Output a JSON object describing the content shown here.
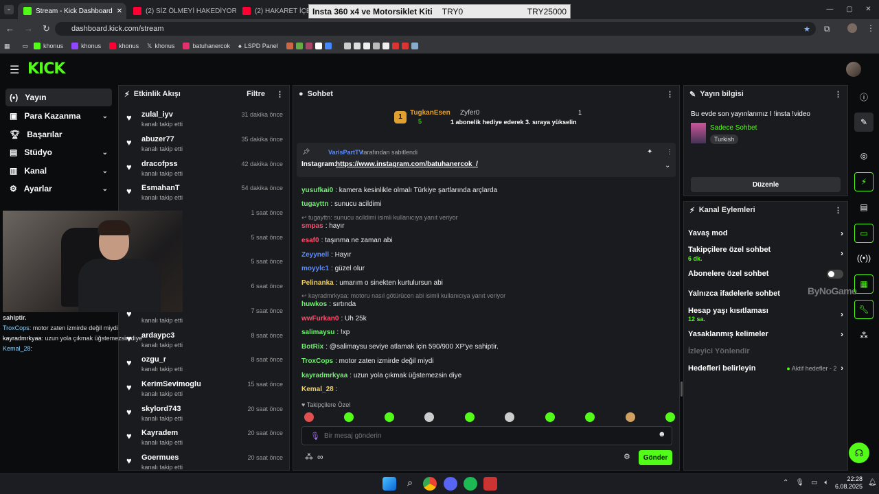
{
  "browser": {
    "tabs": [
      {
        "label": "Stream - Kick Dashboard",
        "color": "#53fc18"
      },
      {
        "label": "(2) SİZ ÖLMEYİ HAKEDİYORSUN",
        "color": "#ff0033"
      },
      {
        "label": "(2) HAKARET İÇERİR! Tü",
        "color": "#ff0033"
      }
    ],
    "url": "dashboard.kick.com/stream",
    "overlay": {
      "title": "Insta 360 x4 ve Motorsiklet Kiti",
      "cur": "TRY0",
      "goal": "TRY25000"
    },
    "bookmarks": [
      {
        "label": "khonus",
        "color": "#53fc18"
      },
      {
        "label": "khonus",
        "color": "#9146ff"
      },
      {
        "label": "khonus",
        "color": "#ff0033"
      },
      {
        "label": "khonus",
        "color": "#ffffff"
      },
      {
        "label": "batuhanercok",
        "color": "#e1306c"
      },
      {
        "label": "LSPD Panel",
        "color": "#ffffff"
      }
    ]
  },
  "nav": {
    "items": [
      {
        "label": "Yayın",
        "icon": "broadcast-icon"
      },
      {
        "label": "Para Kazanma",
        "icon": "money-icon"
      },
      {
        "label": "Başarılar",
        "icon": "trophy-icon"
      },
      {
        "label": "Stüdyo",
        "icon": "studio-icon"
      },
      {
        "label": "Kanal",
        "icon": "channel-icon"
      },
      {
        "label": "Ayarlar",
        "icon": "gear-icon"
      }
    ]
  },
  "left_chat": [
    {
      "user": "",
      "text": "sahiptir."
    },
    {
      "user": "TroxCops",
      "text": ": motor zaten izmirde değil miydi"
    },
    {
      "user": "kayradmrkyaa",
      "text": ": uzun yola çıkmak üğstemezsin diye"
    },
    {
      "user": "Kemal_28",
      "text": ":"
    }
  ],
  "activity": {
    "title": "Etkinlik Akışı",
    "filter": "Filtre",
    "items": [
      {
        "name": "zulal_iyv",
        "sub": "kanalı takip etti",
        "time": "31 dakika önce"
      },
      {
        "name": "abuzer77",
        "sub": "kanalı takip etti",
        "time": "35 dakika önce"
      },
      {
        "name": "dracofpss",
        "sub": "kanalı takip etti",
        "time": "42 dakika önce"
      },
      {
        "name": "EsmahanT",
        "sub": "kanalı takip etti",
        "time": "54 dakika önce"
      },
      {
        "name": "",
        "sub": "",
        "time": "1 saat önce"
      },
      {
        "name": "",
        "sub": "",
        "time": "5 saat önce"
      },
      {
        "name": "",
        "sub": "",
        "time": "5 saat önce"
      },
      {
        "name": "",
        "sub": "",
        "time": "6 saat önce"
      },
      {
        "name": "",
        "sub": "kanalı takip etti",
        "time": "7 saat önce"
      },
      {
        "name": "ardaypc3",
        "sub": "kanalı takip etti",
        "time": "8 saat önce"
      },
      {
        "name": "ozgu_r",
        "sub": "kanalı takip etti",
        "time": "8 saat önce"
      },
      {
        "name": "KerimSevimoglu",
        "sub": "kanalı takip etti",
        "time": "15 saat önce"
      },
      {
        "name": "skylord743",
        "sub": "kanalı takip etti",
        "time": "20 saat önce"
      },
      {
        "name": "Kayradem",
        "sub": "kanalı takip etti",
        "time": "20 saat önce"
      },
      {
        "name": "Goermues",
        "sub": "kanalı takip etti",
        "time": "20 saat önce"
      }
    ]
  },
  "chat": {
    "title": "Sohbet",
    "leader": {
      "rank": "1",
      "name": "TugkanEsen",
      "count": "5",
      "second": "Zyfer0",
      "second_count": "1",
      "gift": "1 abonelik hediye ederek 3. sıraya yükselin"
    },
    "pinned": {
      "by": "VarisPartTV",
      "suffix": "tarafından sabitlendi",
      "label": "Instagram:",
      "link": "https://www.instagram.com/batuhanercok_/"
    },
    "messages": [
      {
        "user": "yusufkai0",
        "color": "#6ef06e",
        "text": ": kamera kesinlikle olmalı Türkiye şartlarında arçlarda"
      },
      {
        "user": "tugayttn",
        "color": "#6ef06e",
        "text": ": sunucu acildimi"
      },
      {
        "reply": "tugayttn: sunucu acildimi isimli kullanıcıya yanıt veriyor"
      },
      {
        "user": "smpas",
        "color": "#ff4d6d",
        "text": ": hayır"
      },
      {
        "user": "esaf0",
        "color": "#ff4d6d",
        "text": ": taşınma ne zaman abi"
      },
      {
        "user": "Zeyynell",
        "color": "#5b8cff",
        "text": ": Hayır"
      },
      {
        "user": "moyylc1",
        "color": "#5b8cff",
        "text": ": güzel olur"
      },
      {
        "user": "Pelinanka",
        "color": "#f0d060",
        "text": ": umarım o sinekten kurtulursun abi"
      },
      {
        "reply": "kayradmrkyaa: motoru nasıl götürücen abi isimli kullanıcıya yanıt veriyor"
      },
      {
        "user": "huwkos",
        "color": "#6ef06e",
        "text": ": sırtında"
      },
      {
        "user": "wwFurkan0",
        "color": "#ff4d6d",
        "text": ": Uh 25k"
      },
      {
        "user": "salimaysu",
        "color": "#6ef06e",
        "text": ": !xp"
      },
      {
        "user": "BotRix",
        "color": "#6ef06e",
        "text": ": @salimaysu seviye atlamak için 590/900 XP'ye sahiptir."
      },
      {
        "user": "TroxCops",
        "color": "#6ef06e",
        "text": ": motor zaten izmirde değil miydi"
      },
      {
        "user": "kayradmrkyaa",
        "color": "#6ef06e",
        "text": ": uzun yola çıkmak üğstemezsin diye"
      },
      {
        "user": "Kemal_28",
        "color": "#f0d060",
        "text": ":"
      }
    ],
    "emote_label": "Takipçilere Özel",
    "placeholder": "Bir mesaj gönderin",
    "send": "Gönder"
  },
  "stream_info": {
    "title": "Yayın bilgisi",
    "stream_title": "Bu evde son yayınlarımız I !insta !video",
    "category": "Sadece Sohbet",
    "tag": "Turkish",
    "edit": "Düzenle"
  },
  "channel_actions": {
    "title": "Kanal Eylemleri",
    "items": [
      {
        "label": "Yavaş mod",
        "sub": ""
      },
      {
        "label": "Takipçilere özel sohbet",
        "sub": "6 dk."
      },
      {
        "label": "Abonelere özel sohbet",
        "sub": ""
      },
      {
        "label": "Yalnızca ifadelerle sohbet",
        "sub": ""
      },
      {
        "label": "Hesap yaşı kısıtlaması",
        "sub": "12 sa."
      },
      {
        "label": "Yasaklanmış kelimeler",
        "sub": ""
      },
      {
        "label": "İzleyici Yönlendir",
        "sub": ""
      },
      {
        "label": "Hedefleri belirleyin",
        "sub": ""
      }
    ],
    "goals_status": "Aktif hedefler - 2"
  },
  "watermark": "ByNoGame",
  "taskbar": {
    "time": "22:28",
    "date": "6.08.2025"
  }
}
